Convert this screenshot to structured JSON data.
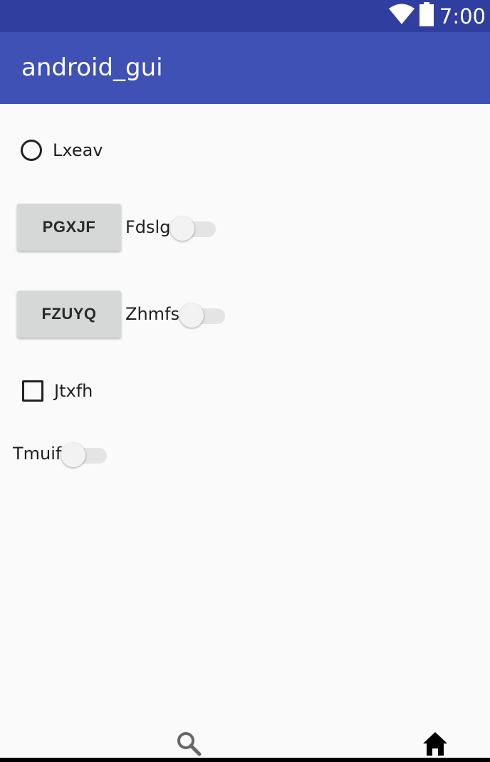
{
  "status_bar": {
    "time": "7:00",
    "icons": [
      "wifi-icon",
      "battery-icon"
    ]
  },
  "app_bar": {
    "title": "android_gui"
  },
  "controls": {
    "radio": {
      "label": "Lxeav",
      "checked": false
    },
    "button1": {
      "label": "PGXJF"
    },
    "switch1": {
      "label": "Fdslg",
      "on": false
    },
    "button2": {
      "label": "FZUYQ"
    },
    "switch2": {
      "label": "Zhmfs",
      "on": false
    },
    "checkbox": {
      "label": "Jtxfh",
      "checked": false
    },
    "switch3": {
      "label": "Tmuif",
      "on": false
    }
  },
  "bottom_nav": {
    "items": [
      {
        "icon": "search-icon",
        "color": "#666666"
      },
      {
        "icon": "home-icon",
        "color": "#000000"
      }
    ]
  },
  "colors": {
    "status_bar": "#303f9f",
    "app_bar": "#3f51b5",
    "background": "#fafafa"
  }
}
